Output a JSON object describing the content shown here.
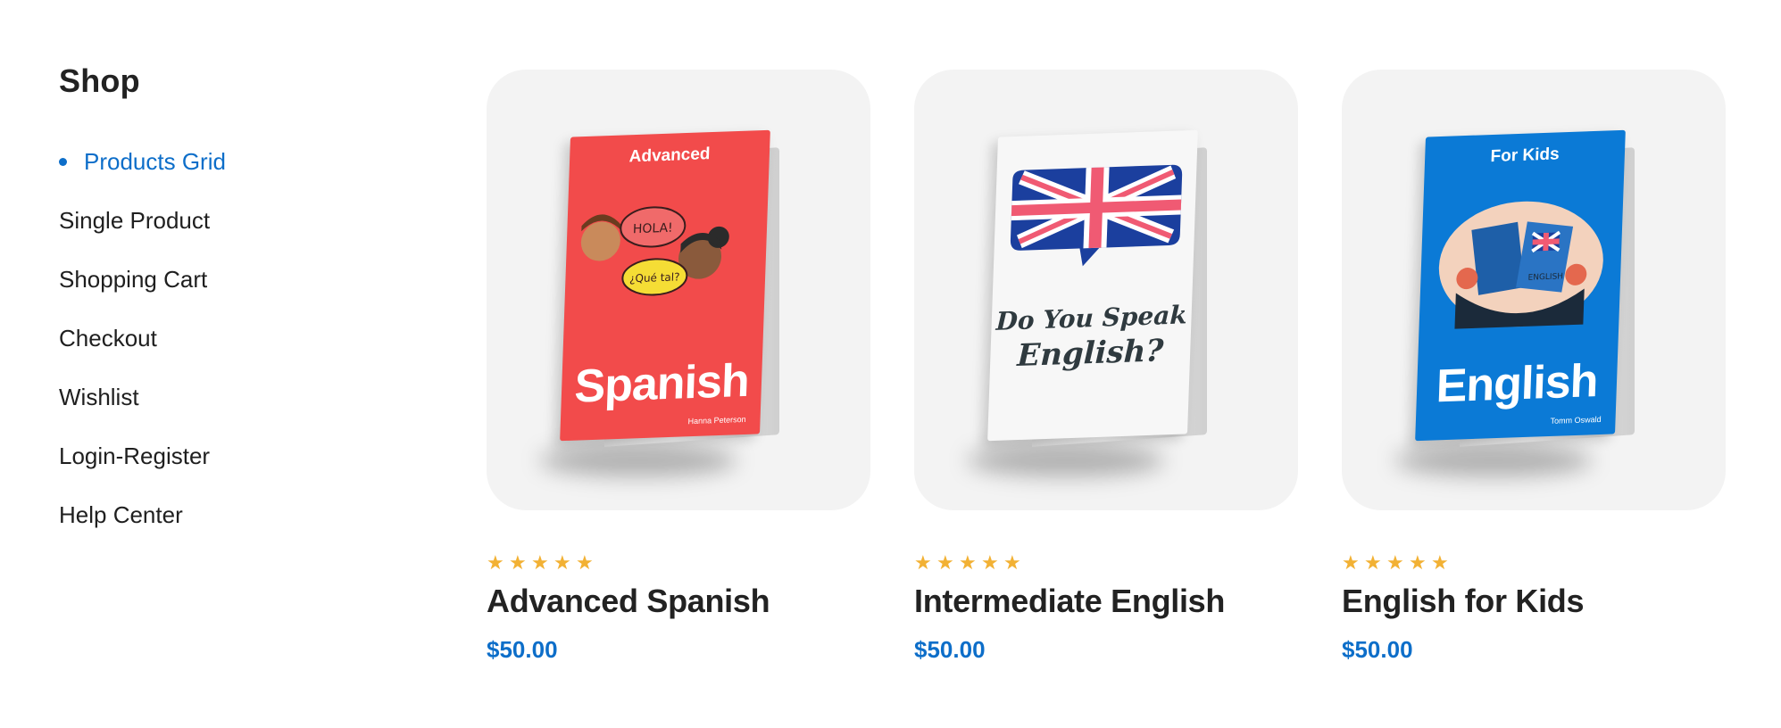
{
  "sidebar": {
    "title": "Shop",
    "items": [
      {
        "label": "Products Grid",
        "active": true
      },
      {
        "label": "Single Product"
      },
      {
        "label": "Shopping Cart"
      },
      {
        "label": "Checkout"
      },
      {
        "label": "Wishlist"
      },
      {
        "label": "Login-Register"
      },
      {
        "label": "Help Center"
      }
    ]
  },
  "colors": {
    "accent": "#0d6ec9",
    "star": "#f2b134",
    "card_bg": "#f3f3f3"
  },
  "products": [
    {
      "name": "Advanced Spanish",
      "price": "$50.00",
      "rating": 5,
      "cover": {
        "top_text": "Advanced",
        "big_text": "Spanish",
        "author": "Hanna Peterson",
        "bubble_1": "HOLA!",
        "bubble_2": "¿Qué tal?",
        "color": "#f24b4b"
      }
    },
    {
      "name": "Intermediate English",
      "price": "$50.00",
      "rating": 5,
      "cover": {
        "line_1": "Do You Speak",
        "line_2": "English?",
        "color": "#f7f7f7"
      }
    },
    {
      "name": "English for Kids",
      "price": "$50.00",
      "rating": 5,
      "cover": {
        "top_text": "For Kids",
        "big_text": "English",
        "author": "Tomm Oswald",
        "book_label": "ENGLISH",
        "color": "#0b7ad6"
      }
    }
  ]
}
